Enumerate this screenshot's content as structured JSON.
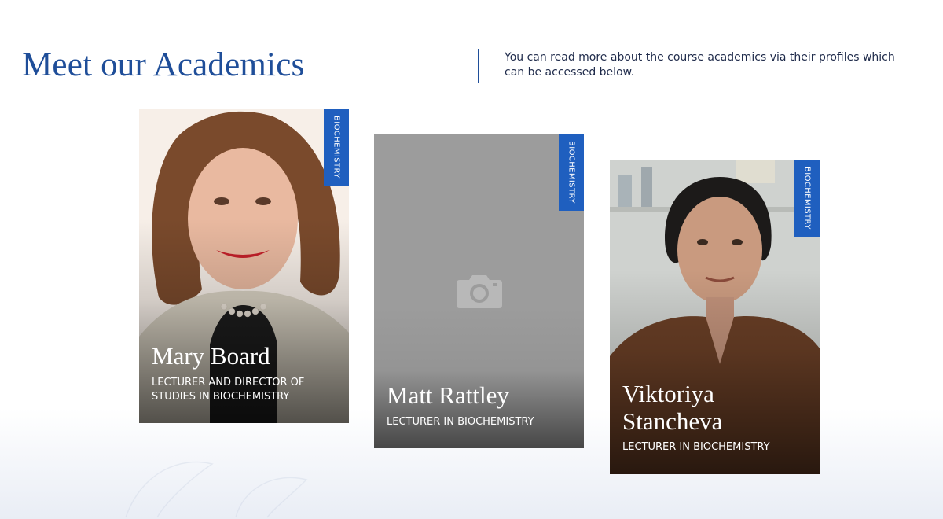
{
  "header": {
    "title": "Meet our Academics",
    "intro": "You can read more about the course academics via their profiles which can be accessed below."
  },
  "academics": [
    {
      "name": "Mary Board",
      "role": "Lecturer and Director of Studies in Biochemistry",
      "subject": "BIOCHEMISTRY",
      "photo": "portrait-woman-curly-hair"
    },
    {
      "name": "Matt Rattley",
      "role": "Lecturer in Biochemistry",
      "subject": "BIOCHEMISTRY",
      "photo": "camera-placeholder-icon"
    },
    {
      "name": "Viktoriya Stancheva",
      "role": "Lecturer in Biochemistry",
      "subject": "BIOCHEMISTRY",
      "photo": "portrait-woman-lab"
    }
  ],
  "colors": {
    "brand_blue": "#1f4e99",
    "badge_blue": "#1f5fbf",
    "placeholder_gray": "#9c9c9c"
  }
}
